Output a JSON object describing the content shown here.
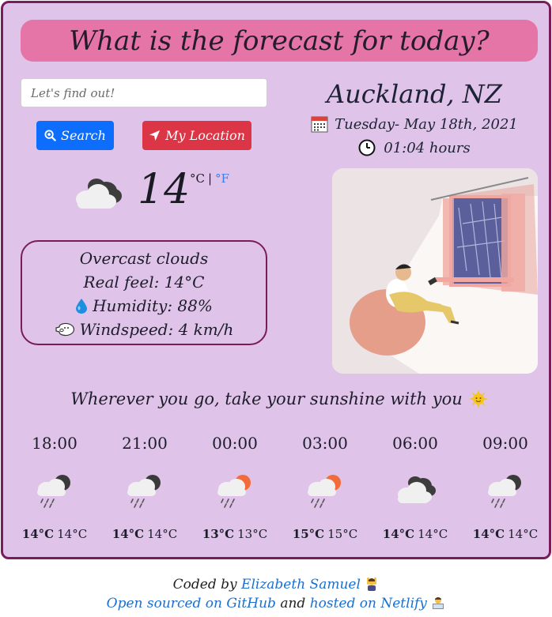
{
  "header": {
    "title": "What is the forecast for today?"
  },
  "search": {
    "placeholder": "Let's find out!",
    "search_label": "Search",
    "location_label": "My Location"
  },
  "location": {
    "city": "Auckland, NZ",
    "date": "Tuesday- May 18th, 2021",
    "time": "01:04 hours"
  },
  "current": {
    "temperature": "14",
    "unit_c": "°C",
    "unit_sep": "|",
    "unit_f": "°F",
    "icon": "cloud-overcast-icon",
    "description": "Overcast clouds",
    "real_feel": "Real feel: 14°C",
    "humidity": "Humidity: 88%",
    "windspeed": "Windspeed: 4 km/h"
  },
  "quote": "Wherever you go, take your sunshine with you",
  "forecast": [
    {
      "time": "18:00",
      "icon": "cloud-rain-night-icon",
      "high": "14°C",
      "low": "14°C"
    },
    {
      "time": "21:00",
      "icon": "cloud-rain-night-icon",
      "high": "14°C",
      "low": "14°C"
    },
    {
      "time": "00:00",
      "icon": "cloud-rain-sun-icon",
      "high": "13°C",
      "low": "13°C"
    },
    {
      "time": "03:00",
      "icon": "cloud-rain-sun-icon",
      "high": "15°C",
      "low": "15°C"
    },
    {
      "time": "06:00",
      "icon": "cloud-overcast-icon",
      "high": "14°C",
      "low": "14°C"
    },
    {
      "time": "09:00",
      "icon": "cloud-rain-night-icon",
      "high": "14°C",
      "low": "14°C"
    }
  ],
  "footer": {
    "coded_by": "Coded by",
    "author": "Elizabeth Samuel",
    "open_sourced": "Open sourced on GitHub",
    "and": "and",
    "hosted": "hosted on Netlify"
  },
  "colors": {
    "card_bg": "#dfc3e8",
    "border": "#7a1b5c",
    "header_bg": "#e575a6",
    "search_btn": "#0d6efd",
    "location_btn": "#dc3545",
    "link": "#1a6fcf"
  }
}
